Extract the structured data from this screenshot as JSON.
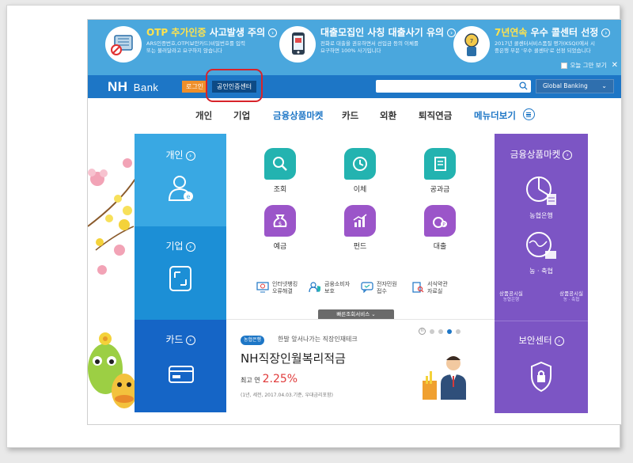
{
  "banner": {
    "notices": [
      {
        "title_highlight": "OTP 추가인증",
        "title_rest": " 사고발생 주의",
        "desc": "ARS인증번호,OTP(보안카드)비밀번호를 입력 또는 불러달라고 요구하지 않습니다",
        "icon": "otp-device-icon"
      },
      {
        "title_highlight": "",
        "title_rest": "대출모집인 사칭 대출사기 유의",
        "desc": "전화로 대출을 권유하면서 선입금 등의 이체를 요구하면 100% 사기입니다",
        "icon": "phone-fraud-icon"
      },
      {
        "title_highlight": "7년연속",
        "title_rest": " 우수 콜센터 선정",
        "desc": "2017년 콜센터서비스품질 평가(KSQI)에서 시중은행 부문 '우수 콜센터'로 선정 되었습니다",
        "icon": "callcenter-award-icon"
      }
    ],
    "close_today": "오늘 그만 보기",
    "close_symbol": "✕"
  },
  "header": {
    "logo_nh": "NH",
    "logo_bank": "Bank",
    "login": "로그인",
    "cert_center": "공인인증센터",
    "search_placeholder": "",
    "global_banking": "Global Banking",
    "global_chevron": "⌄"
  },
  "gnb": {
    "items": [
      "개인",
      "기업",
      "금융상품마켓",
      "카드",
      "외환",
      "퇴직연금",
      "메뉴더보기"
    ]
  },
  "left_panels": {
    "personal": "개인",
    "business": "기업",
    "card": "카드",
    "arrow": "›"
  },
  "services": {
    "row1": [
      "조회",
      "이체",
      "공과금"
    ],
    "row2": [
      "예금",
      "펀드",
      "대출"
    ],
    "minis": [
      {
        "l1": "인터넷뱅킹",
        "l2": "오류해결"
      },
      {
        "l1": "금융소비자",
        "l2": "보호"
      },
      {
        "l1": "전자민원",
        "l2": "접수"
      },
      {
        "l1": "서식약관",
        "l2": "자료실"
      }
    ],
    "quick": "빠른조회서비스 ⌄"
  },
  "promo": {
    "tag": "농협은행",
    "sub": "한발 앞서나가는 직장인재테크",
    "title": "NH직장인월복리적금",
    "rate_label": "최고 연",
    "rate_value": "2.25%",
    "condition": "(1년, 세전, 2017.04.03.기준, 우대금리포함)",
    "pause": "II"
  },
  "right_panel": {
    "title": "금융상품마켓",
    "nh_bank": "농협은행",
    "nonghyup": "농 · 축협",
    "small1_top": "상품공시실",
    "small1_bottom": "농협은행",
    "small2_top": "상품공시실",
    "small2_bottom": "농 · 축협",
    "security": "보안센터",
    "arrow": "›"
  }
}
